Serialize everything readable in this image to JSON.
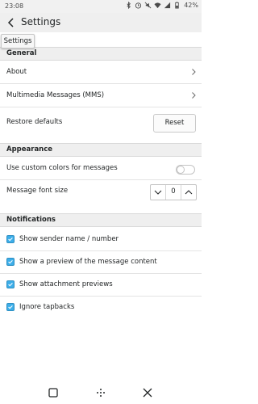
{
  "status_bar": {
    "time": "23:08",
    "battery": "42%"
  },
  "header": {
    "title": "Settings"
  },
  "tooltip": {
    "text": "Settings"
  },
  "sections": {
    "general": {
      "title": "General"
    },
    "appearance": {
      "title": "Appearance"
    },
    "notifications": {
      "title": "Notifications"
    }
  },
  "general": {
    "about_label": "About",
    "mms_label": "Multimedia Messages (MMS)",
    "restore_label": "Restore defaults",
    "reset_button": "Reset"
  },
  "appearance": {
    "custom_colors_label": "Use custom colors for messages",
    "custom_colors_enabled": false,
    "font_size_label": "Message font size",
    "font_size_value": "0"
  },
  "notifications": {
    "items": [
      {
        "label": "Show sender name / number",
        "checked": true
      },
      {
        "label": "Show a preview of the message content",
        "checked": true
      },
      {
        "label": "Show attachment previews",
        "checked": true
      },
      {
        "label": "Ignore tapbacks",
        "checked": true
      }
    ]
  },
  "colors": {
    "accent": "#3daee9",
    "header_bg": "#efefef"
  },
  "icons": [
    "back-arrow-icon",
    "chevron-right-icon",
    "chevron-down-icon",
    "chevron-up-icon",
    "check-icon",
    "bluetooth-icon",
    "alarm-icon",
    "silent-icon",
    "wifi-icon",
    "signal-icon",
    "battery-icon",
    "overview-icon",
    "home-icon",
    "close-icon"
  ]
}
